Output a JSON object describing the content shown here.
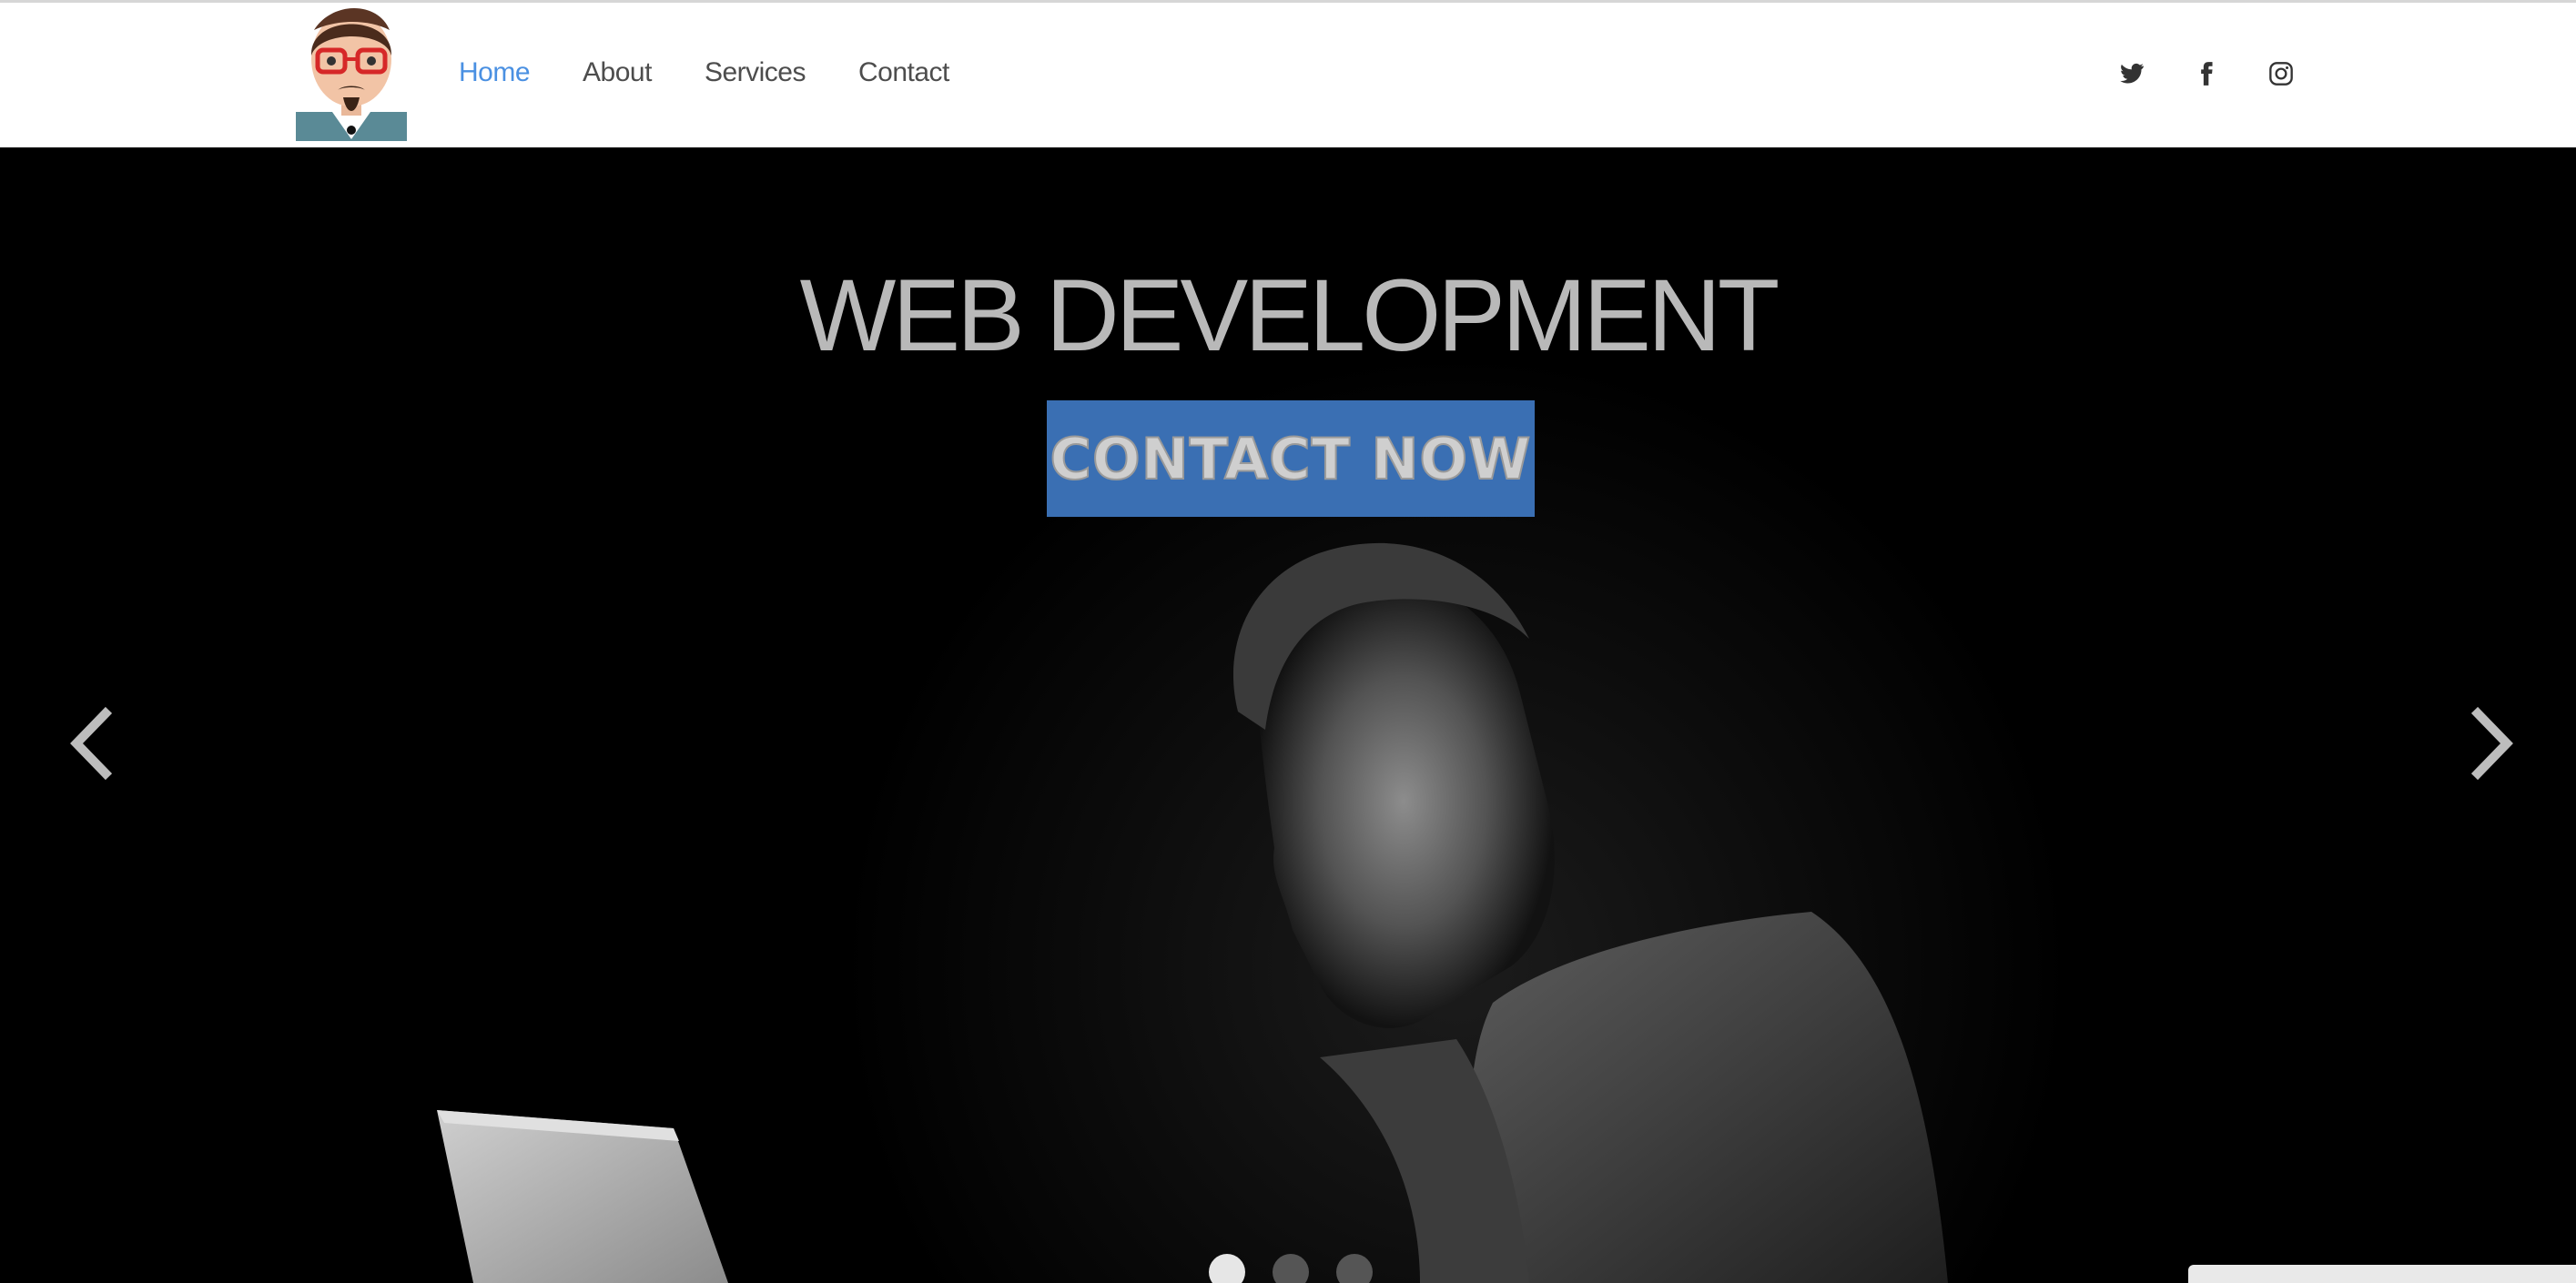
{
  "nav": {
    "items": [
      {
        "label": "Home",
        "active": true
      },
      {
        "label": "About",
        "active": false
      },
      {
        "label": "Services",
        "active": false
      },
      {
        "label": "Contact",
        "active": false
      }
    ]
  },
  "social": [
    "twitter-icon",
    "facebook-icon",
    "instagram-icon"
  ],
  "hero": {
    "title": "WEB DEVELOPMENT",
    "cta_label": "CONTACT NOW",
    "slides_total": 3,
    "active_slide": 1
  },
  "colors": {
    "accent": "#4a90e2",
    "cta_background": "#3a6fb3",
    "nav_text": "#4d4d4d"
  }
}
